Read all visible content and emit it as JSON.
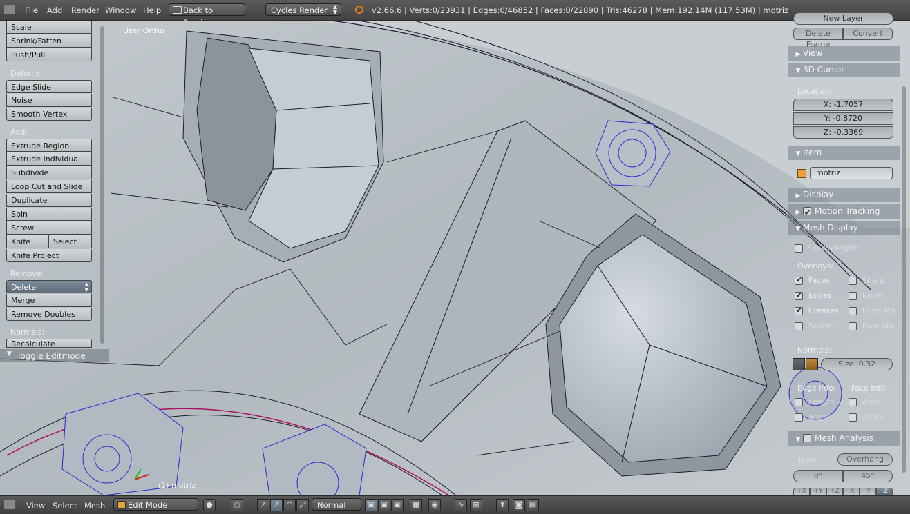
{
  "topbar": {
    "menu": [
      "File",
      "Add",
      "Render",
      "Window",
      "Help"
    ],
    "back_button": "Back to Previous",
    "render_engine": "Cycles Render",
    "stats": "v2.66.6 | Verts:0/23931 | Edges:0/46852 | Faces:0/22890 | Tris:46278 | Mem:192.14M (117.53M) | motriz"
  },
  "viewport": {
    "view_label": "User Ortho",
    "object_label": "(1) motriz"
  },
  "toolshelf": {
    "transform_items": [
      "Scale",
      "Shrink/Fatten",
      "Push/Pull"
    ],
    "deform_label": "Deform:",
    "deform_items": [
      "Edge Slide",
      "Noise",
      "Smooth Vertex"
    ],
    "add_label": "Add:",
    "add_items": [
      "Extrude Region",
      "Extrude Individual",
      "Subdivide",
      "Loop Cut and Slide",
      "Duplicate",
      "Spin",
      "Screw"
    ],
    "knife": "Knife",
    "knife_select": "Select",
    "knife_project": "Knife Project",
    "remove_label": "Remove:",
    "remove_items": [
      "Delete",
      "Merge",
      "Remove Doubles"
    ],
    "normals_label": "Normals:",
    "normals_item": "Recalculate",
    "toggle_editmode": "Toggle Editmode"
  },
  "properties": {
    "new_layer": "New Layer",
    "delete_frame": "Delete Frame",
    "convert": "Convert",
    "view_panel": "View",
    "cursor_panel": "3D Cursor",
    "location_label": "Location:",
    "cursor_x": "X: -1.7057",
    "cursor_y": "Y: -0.8720",
    "cursor_z": "Z: -0.3369",
    "item_panel": "Item",
    "object_name": "motriz",
    "display_panel": "Display",
    "motion_tracking": "Motion Tracking",
    "mesh_display_panel": "Mesh Display",
    "show_weights": "Show Weights",
    "overlays_label": "Overlays:",
    "overlays": [
      {
        "label": "Faces",
        "checked": true
      },
      {
        "label": "Edges",
        "checked": true
      },
      {
        "label": "Creases",
        "checked": true
      },
      {
        "label": "Seams",
        "checked": false
      }
    ],
    "overlays_right": [
      {
        "label": "Sharp",
        "checked": false
      },
      {
        "label": "Bevel",
        "checked": false
      },
      {
        "label": "Edge Ma",
        "checked": false
      },
      {
        "label": "Face Ma",
        "checked": false
      }
    ],
    "normals_label": "Normals:",
    "normals_size": "Size: 0.32",
    "edge_info_label": "Edge Info:",
    "face_info_label": "Face Info:",
    "edge_info": [
      "Length",
      "Angle"
    ],
    "face_info": [
      "Area",
      "Angle"
    ],
    "mesh_analysis_panel": "Mesh Analysis",
    "type_label": "Type:",
    "type_value": "Overhang",
    "angle_min": "0°",
    "angle_max": "45°",
    "axis_buttons": [
      "+X",
      "+Y",
      "+Z",
      "-X",
      "-Y",
      "-Z"
    ]
  },
  "bottombar": {
    "menu": [
      "View",
      "Select",
      "Mesh"
    ],
    "mode": "Edit Mode",
    "orientation": "Normal"
  }
}
